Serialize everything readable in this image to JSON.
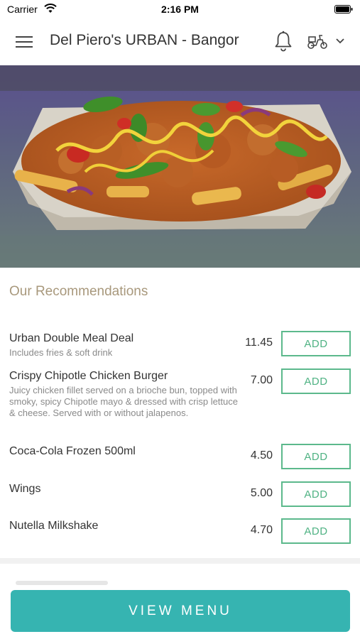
{
  "status_bar": {
    "carrier": "Carrier",
    "time": "2:16 PM",
    "icons": [
      "wifi-icon",
      "battery-icon"
    ]
  },
  "header": {
    "title": "Del Piero's URBAN - Bangor",
    "icons": [
      "menu-icon",
      "bell-icon",
      "scooter-icon",
      "chevron-down-icon"
    ]
  },
  "hero": {
    "icon": "loaded-fries-photo"
  },
  "recommendations": {
    "title": "Our Recommendations",
    "items": [
      {
        "name": "Urban Double Meal Deal",
        "description": "Includes fries & soft drink",
        "price": "11.45",
        "action": "ADD"
      },
      {
        "name": "Crispy Chipotle Chicken Burger",
        "description": "Juicy chicken fillet served on a brioche bun, topped with smoky, spicy Chipotle mayo & dressed with crisp lettuce & cheese. Served with or without jalapenos.",
        "price": "7.00",
        "action": "ADD"
      },
      {
        "name": "Coca-Cola Frozen 500ml",
        "description": "",
        "price": "4.50",
        "action": "ADD"
      },
      {
        "name": "Wings",
        "description": "",
        "price": "5.00",
        "action": "ADD"
      },
      {
        "name": "Nutella Milkshake",
        "description": "",
        "price": "4.70",
        "action": "ADD"
      }
    ]
  },
  "footer": {
    "view_menu_label": "VIEW MENU"
  },
  "colors": {
    "accent_teal": "#36b4b1",
    "add_green": "#4fb283",
    "recs_title": "#a8987c"
  }
}
